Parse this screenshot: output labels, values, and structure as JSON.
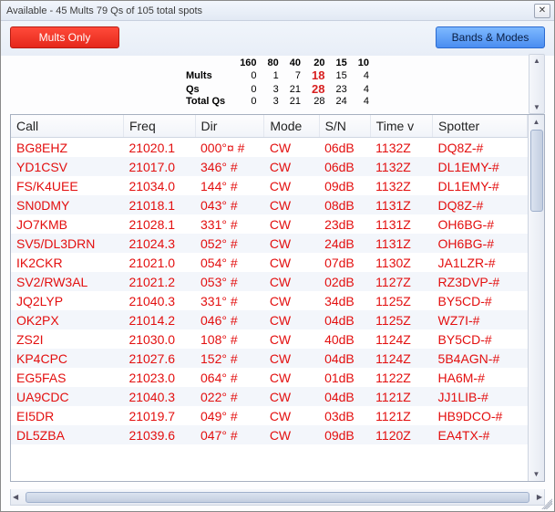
{
  "window": {
    "title": "Available - 45 Mults 79 Qs of 105 total spots"
  },
  "toolbar": {
    "mults_only": "Mults Only",
    "bands_modes": "Bands & Modes"
  },
  "summary": {
    "bands": [
      "160",
      "80",
      "40",
      "20",
      "15",
      "10"
    ],
    "rows": [
      {
        "label": "Mults",
        "cells": [
          "0",
          "1",
          "7",
          "18",
          "15",
          "4"
        ],
        "hl_col": 3
      },
      {
        "label": "Qs",
        "cells": [
          "0",
          "3",
          "21",
          "28",
          "23",
          "4"
        ],
        "hl_col": 3
      },
      {
        "label": "Total Qs",
        "cells": [
          "0",
          "3",
          "21",
          "28",
          "24",
          "4"
        ],
        "hl_col": -1
      }
    ]
  },
  "grid": {
    "cols": [
      "Call",
      "Freq",
      "Dir",
      "Mode",
      "S/N",
      "Time v",
      "Spotter"
    ],
    "rows": [
      {
        "call": "BG8EHZ",
        "freq": "21020.1",
        "dir": "000°¤ #",
        "mode": "CW",
        "sn": "06dB",
        "time": "1132Z",
        "spotter": "DQ8Z-#"
      },
      {
        "call": "YD1CSV",
        "freq": "21017.0",
        "dir": "346° #",
        "mode": "CW",
        "sn": "06dB",
        "time": "1132Z",
        "spotter": "DL1EMY-#"
      },
      {
        "call": "FS/K4UEE",
        "freq": "21034.0",
        "dir": "144° #",
        "mode": "CW",
        "sn": "09dB",
        "time": "1132Z",
        "spotter": "DL1EMY-#"
      },
      {
        "call": "SN0DMY",
        "freq": "21018.1",
        "dir": "043° #",
        "mode": "CW",
        "sn": "08dB",
        "time": "1131Z",
        "spotter": "DQ8Z-#"
      },
      {
        "call": "JO7KMB",
        "freq": "21028.1",
        "dir": "331° #",
        "mode": "CW",
        "sn": "23dB",
        "time": "1131Z",
        "spotter": "OH6BG-#"
      },
      {
        "call": "SV5/DL3DRN",
        "freq": "21024.3",
        "dir": "052° #",
        "mode": "CW",
        "sn": "24dB",
        "time": "1131Z",
        "spotter": "OH6BG-#"
      },
      {
        "call": "IK2CKR",
        "freq": "21021.0",
        "dir": "054° #",
        "mode": "CW",
        "sn": "07dB",
        "time": "1130Z",
        "spotter": "JA1LZR-#"
      },
      {
        "call": "SV2/RW3AL",
        "freq": "21021.2",
        "dir": "053° #",
        "mode": "CW",
        "sn": "02dB",
        "time": "1127Z",
        "spotter": "RZ3DVP-#"
      },
      {
        "call": "JQ2LYP",
        "freq": "21040.3",
        "dir": "331° #",
        "mode": "CW",
        "sn": "34dB",
        "time": "1125Z",
        "spotter": "BY5CD-#"
      },
      {
        "call": "OK2PX",
        "freq": "21014.2",
        "dir": "046° #",
        "mode": "CW",
        "sn": "04dB",
        "time": "1125Z",
        "spotter": "WZ7I-#"
      },
      {
        "call": "ZS2I",
        "freq": "21030.0",
        "dir": "108° #",
        "mode": "CW",
        "sn": "40dB",
        "time": "1124Z",
        "spotter": "BY5CD-#"
      },
      {
        "call": "KP4CPC",
        "freq": "21027.6",
        "dir": "152° #",
        "mode": "CW",
        "sn": "04dB",
        "time": "1124Z",
        "spotter": "5B4AGN-#"
      },
      {
        "call": "EG5FAS",
        "freq": "21023.0",
        "dir": "064° #",
        "mode": "CW",
        "sn": "01dB",
        "time": "1122Z",
        "spotter": "HA6M-#"
      },
      {
        "call": "UA9CDC",
        "freq": "21040.3",
        "dir": "022° #",
        "mode": "CW",
        "sn": "04dB",
        "time": "1121Z",
        "spotter": "JJ1LIB-#"
      },
      {
        "call": "EI5DR",
        "freq": "21019.7",
        "dir": "049° #",
        "mode": "CW",
        "sn": "03dB",
        "time": "1121Z",
        "spotter": "HB9DCO-#"
      },
      {
        "call": "DL5ZBA",
        "freq": "21039.6",
        "dir": "047° #",
        "mode": "CW",
        "sn": "09dB",
        "time": "1120Z",
        "spotter": "EA4TX-#"
      }
    ]
  }
}
